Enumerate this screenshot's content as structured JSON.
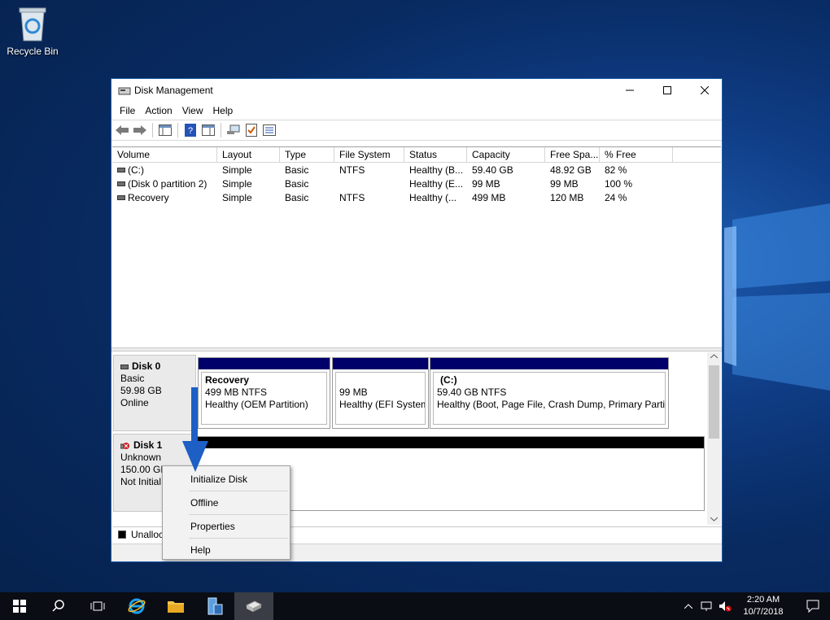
{
  "desktop": {
    "recycle_bin_label": "Recycle Bin"
  },
  "window": {
    "title": "Disk Management",
    "menu": [
      "File",
      "Action",
      "View",
      "Help"
    ]
  },
  "volume_list": {
    "columns": [
      "Volume",
      "Layout",
      "Type",
      "File System",
      "Status",
      "Capacity",
      "Free Spa...",
      "% Free"
    ],
    "rows": [
      [
        "(C:)",
        "Simple",
        "Basic",
        "NTFS",
        "Healthy (B...",
        "59.40 GB",
        "48.92 GB",
        "82 %"
      ],
      [
        "(Disk 0 partition 2)",
        "Simple",
        "Basic",
        "",
        "Healthy (E...",
        "99 MB",
        "99 MB",
        "100 %"
      ],
      [
        "Recovery",
        "Simple",
        "Basic",
        "NTFS",
        "Healthy (...",
        "499 MB",
        "120 MB",
        "24 %"
      ]
    ]
  },
  "disk0": {
    "name": "Disk 0",
    "type": "Basic",
    "size": "59.98 GB",
    "status": "Online",
    "partitions": [
      {
        "title": "Recovery",
        "size": "499 MB NTFS",
        "status": "Healthy (OEM Partition)"
      },
      {
        "title": "",
        "size": "99 MB",
        "status": "Healthy (EFI System"
      },
      {
        "title": "(C:)",
        "size": "59.40 GB NTFS",
        "status": "Healthy (Boot, Page File, Crash Dump, Primary Partit"
      }
    ]
  },
  "disk1": {
    "name": "Disk 1",
    "type": "Unknown",
    "size": "150.00 GB",
    "status": "Not Initial"
  },
  "legend": {
    "unallocated": "Unalloc"
  },
  "context_menu": [
    "Initialize Disk",
    "Offline",
    "Properties",
    "Help"
  ],
  "taskbar": {
    "time": "2:20 AM",
    "date": "10/7/2018"
  },
  "colors": {
    "partition_bar": "#00006a",
    "unallocated_bar": "#000000",
    "taskbar": "#0b0d14"
  }
}
